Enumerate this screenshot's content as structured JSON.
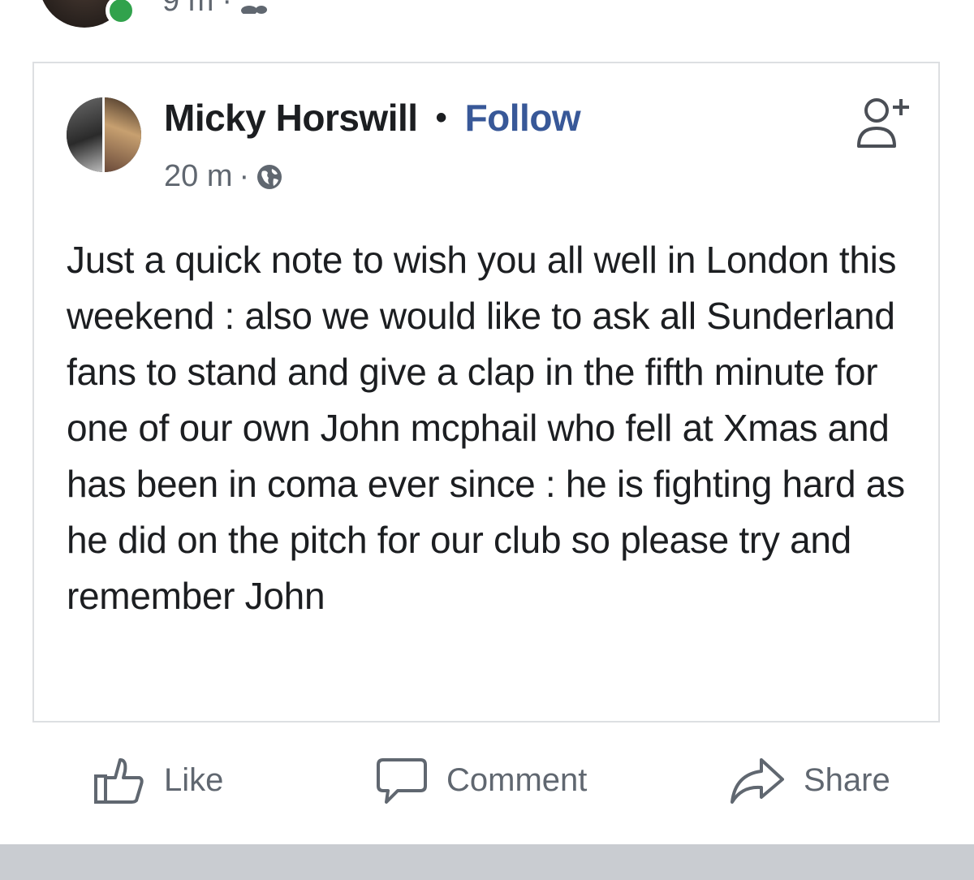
{
  "outer_post": {
    "time": "9 m",
    "separator": "·",
    "audience_icon": "friends-icon",
    "online_status_color": "#31a24c"
  },
  "shared_post": {
    "author": "Micky Horswill",
    "separator": "•",
    "follow_label": "Follow",
    "follow_color": "#385898",
    "time": "20 m",
    "time_separator": "·",
    "audience_icon": "globe-icon",
    "add_friend_icon": "add-friend-icon",
    "text": "Just a quick note to wish you all well in London this weekend : also we would like to ask all Sunderland fans to stand and give a clap in the fifth minute for one of our own John mcphail who fell at Xmas and has been in coma ever since : he is fighting hard as he did on the pitch for our club so please try and remember John"
  },
  "actions": {
    "like": {
      "label": "Like",
      "icon": "thumbs-up-icon"
    },
    "comment": {
      "label": "Comment",
      "icon": "comment-bubble-icon"
    },
    "share": {
      "label": "Share",
      "icon": "share-arrow-icon"
    }
  }
}
